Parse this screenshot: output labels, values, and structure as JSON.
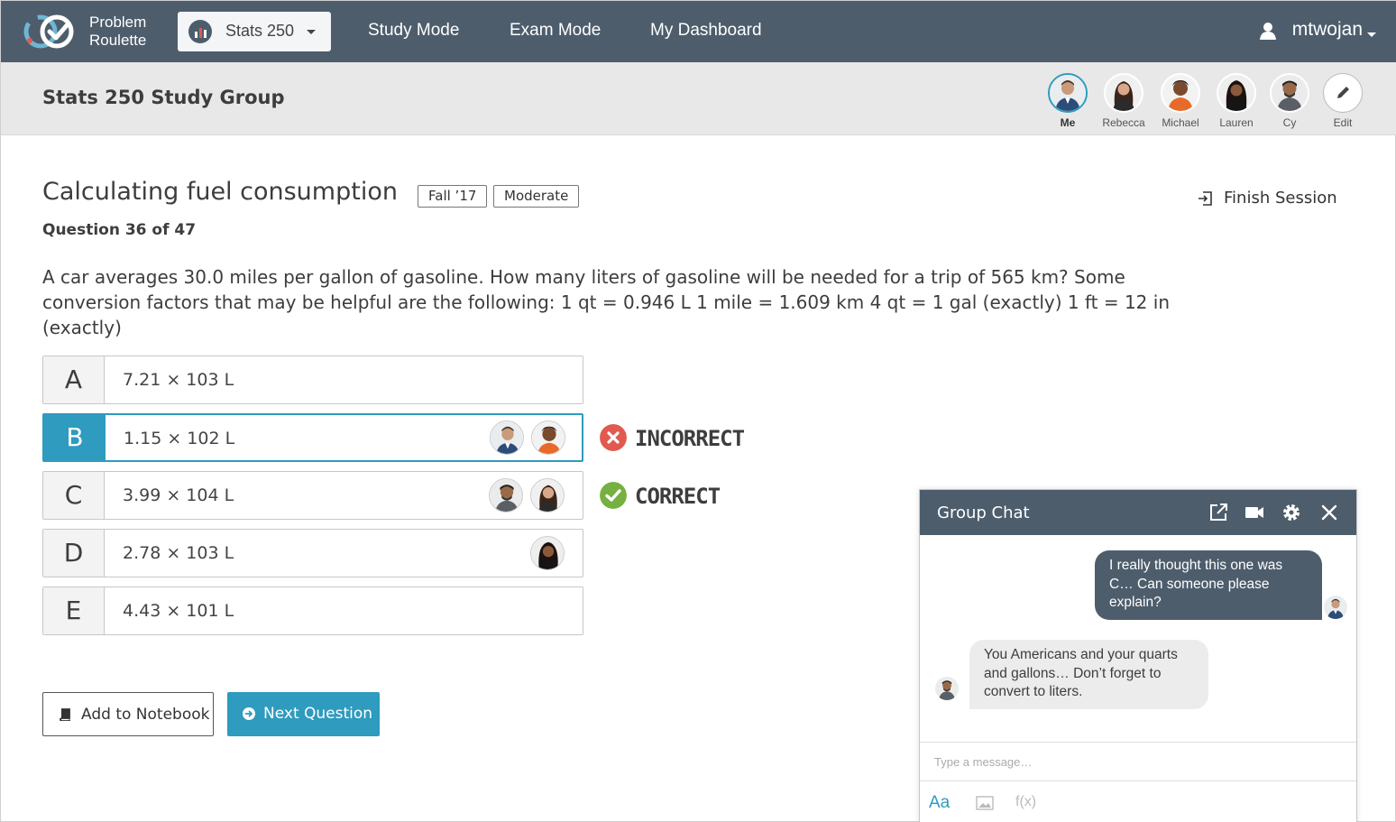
{
  "nav": {
    "brand_line1": "Problem",
    "brand_line2": "Roulette",
    "course": "Stats 250",
    "links": [
      "Study Mode",
      "Exam Mode",
      "My Dashboard"
    ],
    "username": "mtwojan"
  },
  "group": {
    "title": "Stats 250 Study Group",
    "members": [
      "Me",
      "Rebecca",
      "Michael",
      "Lauren",
      "Cy"
    ],
    "edit_label": "Edit"
  },
  "question": {
    "title": "Calculating fuel consumption",
    "tags": [
      "Fall ’17",
      "Moderate"
    ],
    "count": "Question 36 of 47",
    "finish_label": "Finish Session",
    "text": "A car averages 30.0 miles per gallon of gasoline. How many liters of gasoline will be needed for a trip of 565 km? Some conversion factors that may be helpful are the following: 1 qt = 0.946 L 1 mile = 1.609 km 4 qt = 1 gal (exactly) 1 ft = 12 in (exactly)"
  },
  "answers": [
    {
      "letter": "A",
      "value": "7.21 × 103 L"
    },
    {
      "letter": "B",
      "value": "1.15 × 102 L"
    },
    {
      "letter": "C",
      "value": "3.99 × 104 L"
    },
    {
      "letter": "D",
      "value": "2.78 × 103 L"
    },
    {
      "letter": "E",
      "value": "4.43 × 101 L"
    }
  ],
  "results": {
    "incorrect": "INCORRECT",
    "correct": "CORRECT"
  },
  "buttons": {
    "notebook": "Add to Notebook",
    "next": "Next Question"
  },
  "chat": {
    "title": "Group Chat",
    "messages": [
      "I really thought this one was C… Can someone please explain?",
      "You Americans and your quarts and gallons… Don’t forget to convert to liters."
    ],
    "placeholder": "Type a message…",
    "format_label": "Aa",
    "fx_label": "f(x)"
  },
  "colors": {
    "nav_bg": "#4d5d6c",
    "accent": "#2e9bbf",
    "incorrect": "#e05a4f",
    "correct": "#76b041"
  }
}
